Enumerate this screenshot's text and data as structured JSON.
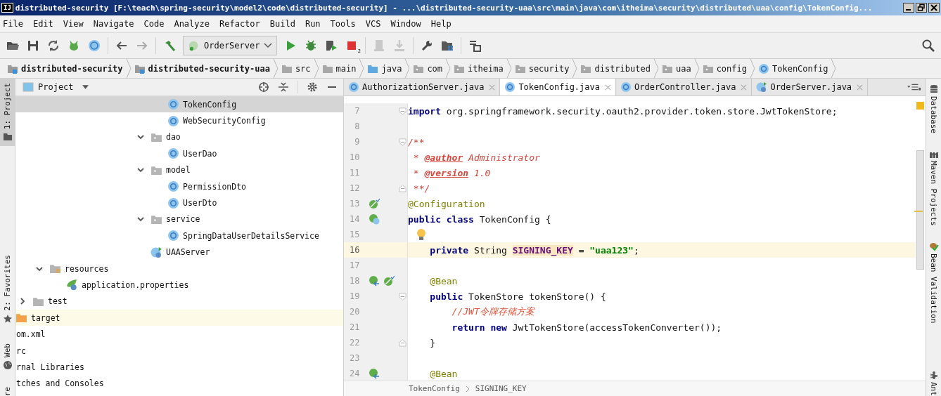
{
  "window": {
    "logo": "IJ",
    "title": "distributed-security [F:\\teach\\spring-security\\model2\\code\\distributed-security] - ...\\distributed-security-uaa\\src\\main\\java\\com\\itheima\\security\\distributed\\uaa\\config\\TokenConfig..."
  },
  "menu": [
    "File",
    "Edit",
    "View",
    "Navigate",
    "Code",
    "Analyze",
    "Refactor",
    "Build",
    "Run",
    "Tools",
    "VCS",
    "Window",
    "Help"
  ],
  "toolbar": {
    "run_config": "OrderServer",
    "stop_badge": "2"
  },
  "nav_path": [
    {
      "label": "distributed-security",
      "kind": "module"
    },
    {
      "label": "distributed-security-uaa",
      "kind": "module"
    },
    {
      "label": "src",
      "kind": "folder"
    },
    {
      "label": "main",
      "kind": "folder"
    },
    {
      "label": "java",
      "kind": "source"
    },
    {
      "label": "com",
      "kind": "package"
    },
    {
      "label": "itheima",
      "kind": "package"
    },
    {
      "label": "security",
      "kind": "package"
    },
    {
      "label": "distributed",
      "kind": "package"
    },
    {
      "label": "uaa",
      "kind": "package"
    },
    {
      "label": "config",
      "kind": "package"
    },
    {
      "label": "TokenConfig",
      "kind": "class"
    }
  ],
  "left_tool_tabs": [
    {
      "label": "1: Project",
      "kind": "project",
      "selected": true
    },
    {
      "label": "2: Favorites",
      "kind": "favorites",
      "selected": false
    },
    {
      "label": "Web",
      "kind": "web",
      "selected": false
    },
    {
      "label": "re",
      "kind": "structure",
      "selected": false
    }
  ],
  "project_panel": {
    "title": "Project",
    "tree": [
      {
        "children": [
          {
            "children": [
              {
                "children": [
                  {
                    "children": [
                      {
                        "children": [
                          {
                            "children": [
                              {
                                "children": [
                                  {
                                    "children": [
                                      {
                                        "children": [
                                          {
                                            "label": "TokenConfig",
                                            "kind": "class",
                                            "selected": true
                                          },
                                          {
                                            "label": "WebSecurityConfig",
                                            "kind": "class",
                                            "selected": false
                                          }
                                        ]
                                      },
                                      {
                                        "label": "dao",
                                        "kind": "package",
                                        "expanded": true,
                                        "selected": false,
                                        "children": [
                                          {
                                            "label": "UserDao",
                                            "kind": "class",
                                            "selected": false
                                          }
                                        ]
                                      },
                                      {
                                        "label": "model",
                                        "kind": "package",
                                        "expanded": true,
                                        "selected": false,
                                        "children": [
                                          {
                                            "label": "PermissionDto",
                                            "kind": "class",
                                            "selected": false
                                          },
                                          {
                                            "label": "UserDto",
                                            "kind": "class",
                                            "selected": false
                                          }
                                        ]
                                      },
                                      {
                                        "label": "service",
                                        "kind": "package",
                                        "expanded": true,
                                        "selected": false,
                                        "children": [
                                          {
                                            "label": "SpringDataUserDetailsService",
                                            "kind": "class",
                                            "selected": false
                                          }
                                        ]
                                      },
                                      {
                                        "label": "UAAServer",
                                        "kind": "boot-class",
                                        "selected": false
                                      }
                                    ]
                                  }
                                ]
                              }
                            ]
                          }
                        ]
                      }
                    ]
                  }
                ]
              },
              {
                "label": "resources",
                "kind": "resources",
                "expanded": true,
                "selected": false,
                "children": [
                  {
                    "label": "application.properties",
                    "kind": "properties",
                    "selected": false
                  }
                ]
              }
            ]
          },
          {
            "label": "test",
            "kind": "folder",
            "expanded": false,
            "selected": false
          }
        ]
      },
      {
        "label": "target",
        "kind": "excluded",
        "selected": false
      },
      {
        "label": "om.xml",
        "kind": "clipped",
        "selected": false
      },
      {
        "label": "rc",
        "kind": "clipped",
        "selected": false
      },
      {
        "label": "rnal Libraries",
        "kind": "clipped",
        "selected": false
      },
      {
        "label": "tches and Consoles",
        "kind": "clipped",
        "selected": false
      }
    ]
  },
  "editor": {
    "tabs": [
      {
        "label": "AuthorizationServer.java",
        "kind": "class",
        "selected": false
      },
      {
        "label": "TokenConfig.java",
        "kind": "class",
        "selected": true
      },
      {
        "label": "OrderController.java",
        "kind": "class",
        "selected": false
      },
      {
        "label": "OrderServer.java",
        "kind": "boot-class",
        "selected": false
      }
    ],
    "lines": [
      {
        "num": "7",
        "current": false,
        "marks": [
          {
            "kind": "fold-open"
          }
        ],
        "tokens": [
          {
            "t": "import",
            "kind": "kw"
          },
          {
            "t": " org.springframework.security.oauth2.provider.token.store.JwtTokenStore;",
            "kind": "plain"
          }
        ]
      },
      {
        "num": "8",
        "current": false
      },
      {
        "num": "9",
        "current": false,
        "marks": [
          {
            "kind": "fold-open"
          }
        ],
        "tokens": [
          {
            "t": "/**",
            "kind": "doc"
          }
        ]
      },
      {
        "num": "10",
        "current": false,
        "tokens": [
          {
            "t": " * ",
            "kind": "doc"
          },
          {
            "t": "@author",
            "kind": "doctag"
          },
          {
            "t": " Administrator",
            "kind": "doc"
          }
        ]
      },
      {
        "num": "11",
        "current": false,
        "tokens": [
          {
            "t": " * ",
            "kind": "doc"
          },
          {
            "t": "@version",
            "kind": "doctag"
          },
          {
            "t": " 1.0",
            "kind": "doc"
          }
        ]
      },
      {
        "num": "12",
        "current": false,
        "marks": [
          {
            "kind": "fold-close"
          }
        ],
        "tokens": [
          {
            "t": " **/",
            "kind": "doc"
          }
        ]
      },
      {
        "num": "13",
        "current": false,
        "marks": [
          {
            "kind": "bean"
          }
        ],
        "tokens": [
          {
            "t": "@Configuration",
            "kind": "annot"
          }
        ]
      },
      {
        "num": "14",
        "current": false,
        "marks": [
          {
            "kind": "class-bean"
          }
        ],
        "tokens": [
          {
            "t": "public class",
            "kind": "kw"
          },
          {
            "t": " TokenConfig {",
            "kind": "plain"
          }
        ]
      },
      {
        "num": "15",
        "current": false,
        "marks": [
          {
            "kind": "intention"
          }
        ]
      },
      {
        "num": "16",
        "current": true,
        "tokens": [
          {
            "t": "    private",
            "kind": "kw"
          },
          {
            "t": " String ",
            "kind": "plain"
          },
          {
            "t": "SIGNING_KEY",
            "kind": "field"
          },
          {
            "t": " = ",
            "kind": "plain"
          },
          {
            "t": "\"uaa123\"",
            "kind": "str"
          },
          {
            "t": ";",
            "kind": "plain"
          }
        ]
      },
      {
        "num": "17",
        "current": false
      },
      {
        "num": "18",
        "current": false,
        "marks": [
          {
            "kind": "bean-nav"
          },
          {
            "kind": "bean"
          }
        ],
        "tokens": [
          {
            "t": "    @Bean",
            "kind": "annot"
          }
        ]
      },
      {
        "num": "19",
        "current": false,
        "marks": [
          {
            "kind": "fold-open"
          }
        ],
        "tokens": [
          {
            "t": "    public",
            "kind": "kw"
          },
          {
            "t": " TokenStore tokenStore() {",
            "kind": "plain"
          }
        ]
      },
      {
        "num": "20",
        "current": false,
        "tokens": [
          {
            "t": "        //JWT令牌存储方案",
            "kind": "comment"
          }
        ]
      },
      {
        "num": "21",
        "current": false,
        "tokens": [
          {
            "t": "        return new",
            "kind": "kw"
          },
          {
            "t": " JwtTokenStore(accessTokenConverter());",
            "kind": "plain"
          }
        ]
      },
      {
        "num": "22",
        "current": false,
        "marks": [
          {
            "kind": "fold-close"
          }
        ],
        "tokens": [
          {
            "t": "    }",
            "kind": "plain"
          }
        ]
      },
      {
        "num": "23",
        "current": false
      },
      {
        "num": "24",
        "current": false,
        "marks": [
          {
            "kind": "bean-nav"
          }
        ],
        "tokens": [
          {
            "t": "    @Bean",
            "kind": "annot"
          }
        ]
      }
    ],
    "breadcrumb": [
      "TokenConfig",
      "SIGNING_KEY"
    ]
  },
  "right_tool_tabs": [
    {
      "label": "Database",
      "kind": "database"
    },
    {
      "label": "Maven Projects",
      "kind": "maven"
    },
    {
      "label": "Bean Validation",
      "kind": "bean-validation"
    },
    {
      "label": "Ant",
      "kind": "ant"
    }
  ]
}
